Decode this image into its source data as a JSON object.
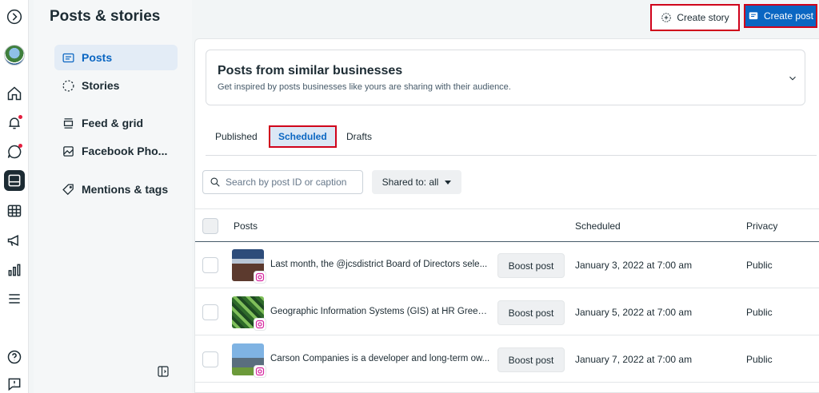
{
  "header": {
    "title": "Posts & stories",
    "create_story_label": "Create story",
    "create_post_label": "Create post"
  },
  "rail": {
    "icons": [
      "expand-icon",
      "avatar",
      "home-icon",
      "bell-icon",
      "chat-icon",
      "posts-icon",
      "table-icon",
      "megaphone-icon",
      "bar-chart-icon",
      "menu-icon",
      "help-icon",
      "feedback-icon"
    ]
  },
  "submenu": {
    "items": [
      {
        "label": "Posts",
        "icon": "posts-icon",
        "active": true
      },
      {
        "label": "Stories",
        "icon": "stories-icon",
        "active": false
      },
      {
        "label": "Feed & grid",
        "icon": "feed-icon",
        "active": false
      },
      {
        "label": "Facebook Pho...",
        "icon": "photo-icon",
        "active": false
      },
      {
        "label": "Mentions & tags",
        "icon": "tag-icon",
        "active": false
      }
    ]
  },
  "similar": {
    "title": "Posts from similar businesses",
    "subtitle": "Get inspired by posts businesses like yours are sharing with their audience."
  },
  "tabs": [
    {
      "label": "Published",
      "active": false
    },
    {
      "label": "Scheduled",
      "active": true
    },
    {
      "label": "Drafts",
      "active": false
    }
  ],
  "filters": {
    "search_placeholder": "Search by post ID or caption",
    "shared_label": "Shared to: all"
  },
  "table": {
    "columns": [
      "Posts",
      "Scheduled",
      "Privacy"
    ],
    "rows": [
      {
        "caption": "Last month, the @jcsdistrict Board of Directors sele...",
        "boost": "Boost post",
        "scheduled": "January 3, 2022 at 7:00 am",
        "privacy": "Public"
      },
      {
        "caption": "Geographic Information Systems (GIS) at HR Green i...",
        "boost": "Boost post",
        "scheduled": "January 5, 2022 at 7:00 am",
        "privacy": "Public"
      },
      {
        "caption": "Carson Companies is a developer and long-term ow...",
        "boost": "Boost post",
        "scheduled": "January 7, 2022 at 7:00 am",
        "privacy": "Public"
      }
    ]
  },
  "colors": {
    "accent": "#0a66c2",
    "highlight_border": "#d0021b",
    "text": "#1c2b33"
  }
}
